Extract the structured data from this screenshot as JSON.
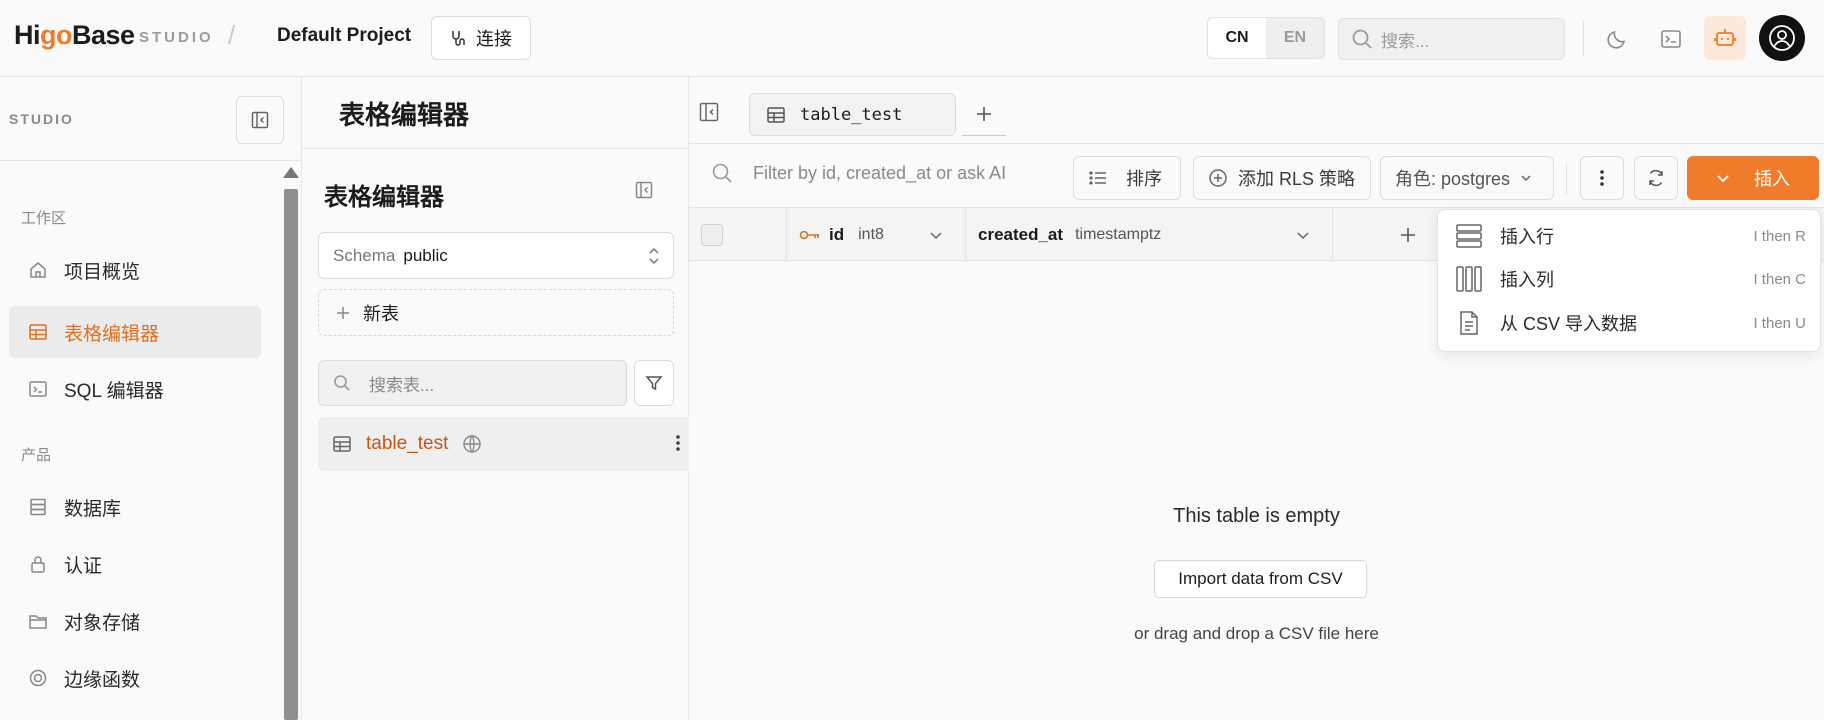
{
  "header": {
    "logo": {
      "pre": "Hi",
      "accent": "g",
      "mid": "",
      "accent2": "o",
      "post": "Base"
    },
    "studio_tag": "STUDIO",
    "separator": "/",
    "project": "Default Project",
    "connect_label": "连接",
    "lang_active": "CN",
    "lang_inactive": "EN",
    "search_placeholder": "搜索..."
  },
  "sidebar": {
    "studio_label": "STUDIO",
    "sections": {
      "workspace": "工作区",
      "product": "产品"
    },
    "items": [
      {
        "label": "项目概览",
        "icon": "home-icon"
      },
      {
        "label": "表格编辑器",
        "icon": "table-icon",
        "active": true
      },
      {
        "label": "SQL 编辑器",
        "icon": "terminal-icon"
      },
      {
        "label": "数据库",
        "icon": "database-icon"
      },
      {
        "label": "认证",
        "icon": "lock-icon"
      },
      {
        "label": "对象存储",
        "icon": "folder-icon"
      },
      {
        "label": "边缘函数",
        "icon": "globe-icon"
      }
    ]
  },
  "table_list": {
    "title": "表格编辑器",
    "subtitle": "表格编辑器",
    "schema_label": "Schema",
    "schema_value": "public",
    "new_table": "新表",
    "search_placeholder": "搜索表...",
    "tables": [
      {
        "name": "table_test"
      }
    ]
  },
  "main": {
    "tab_label": "table_test",
    "filter_placeholder": "Filter by id, created_at or ask AI",
    "sort_label": "排序",
    "rls_label": "添加 RLS 策略",
    "role_label": "角色: postgres",
    "insert_label": "插入",
    "columns": [
      {
        "name": "id",
        "type": "int8"
      },
      {
        "name": "created_at",
        "type": "timestamptz"
      }
    ],
    "empty_title": "This table is empty",
    "import_label": "Import data from CSV",
    "empty_hint": "or drag and drop a CSV file here"
  },
  "insert_menu": {
    "items": [
      {
        "label": "插入行",
        "shortcut": "I then R"
      },
      {
        "label": "插入列",
        "shortcut": "I then C"
      },
      {
        "label": "从 CSV 导入数据",
        "shortcut": "I then U"
      }
    ]
  },
  "colors": {
    "accent": "#f07b2b",
    "active_text": "#e0701f",
    "link": "#c2571a"
  }
}
